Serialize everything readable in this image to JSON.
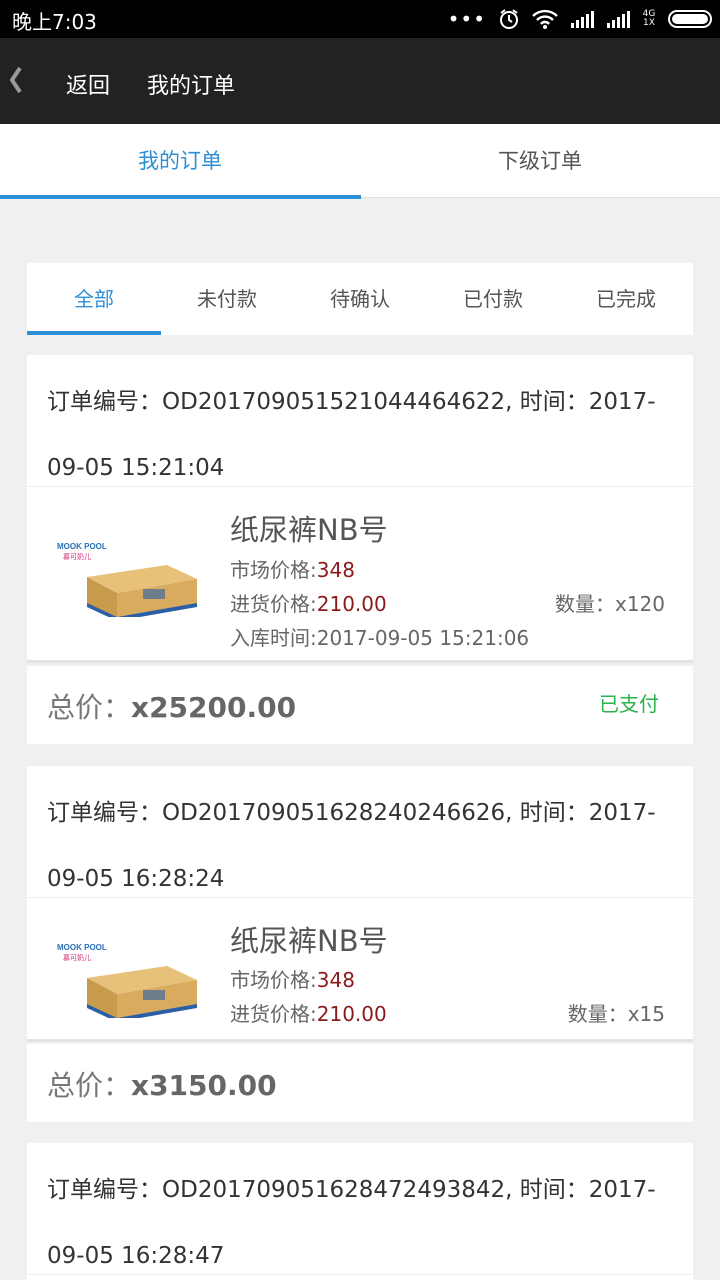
{
  "status_bar": {
    "time": "晚上7:03",
    "net_top": "4G",
    "net_bottom": "1X"
  },
  "header": {
    "back_label": "返回",
    "title": "我的订单"
  },
  "top_tabs": [
    {
      "label": "我的订单"
    },
    {
      "label": "下级订单"
    }
  ],
  "filter_tabs": [
    {
      "label": "全部"
    },
    {
      "label": "未付款"
    },
    {
      "label": "待确认"
    },
    {
      "label": "已付款"
    },
    {
      "label": "已完成"
    }
  ],
  "orders": [
    {
      "head_line1": "订单编号：OD20170905152104446462​2, 时间：2017-",
      "head_line2": "09-05 15:21:04",
      "product_name": "纸尿裤NB号",
      "market_label": "市场价格:",
      "market_price": "348",
      "purchase_label": "进货价格:",
      "purchase_price": "210.00",
      "quantity": "数量：x120",
      "stock_time": "入库时间:2017-09-05 15:21:06",
      "total_label": "总价：",
      "total_value": "x25200.00",
      "status": "已支付"
    },
    {
      "head_line1": "订单编号：OD20170905162824024662​6, 时间：2017-",
      "head_line2": "09-05 16:28:24",
      "product_name": "纸尿裤NB号",
      "market_label": "市场价格:",
      "market_price": "348",
      "purchase_label": "进货价格:",
      "purchase_price": "210.00",
      "quantity": "数量：x15",
      "total_label": "总价：",
      "total_value": "x3150.00"
    },
    {
      "head_line1": "订单编号：OD20170905162847249384​2, 时间：2017-",
      "head_line2": "09-05 16:28:47"
    }
  ],
  "colors": {
    "accent": "#2f8fd6",
    "paid": "#2db34a",
    "price": "#8b1a1a",
    "header_bg": "#222222"
  }
}
